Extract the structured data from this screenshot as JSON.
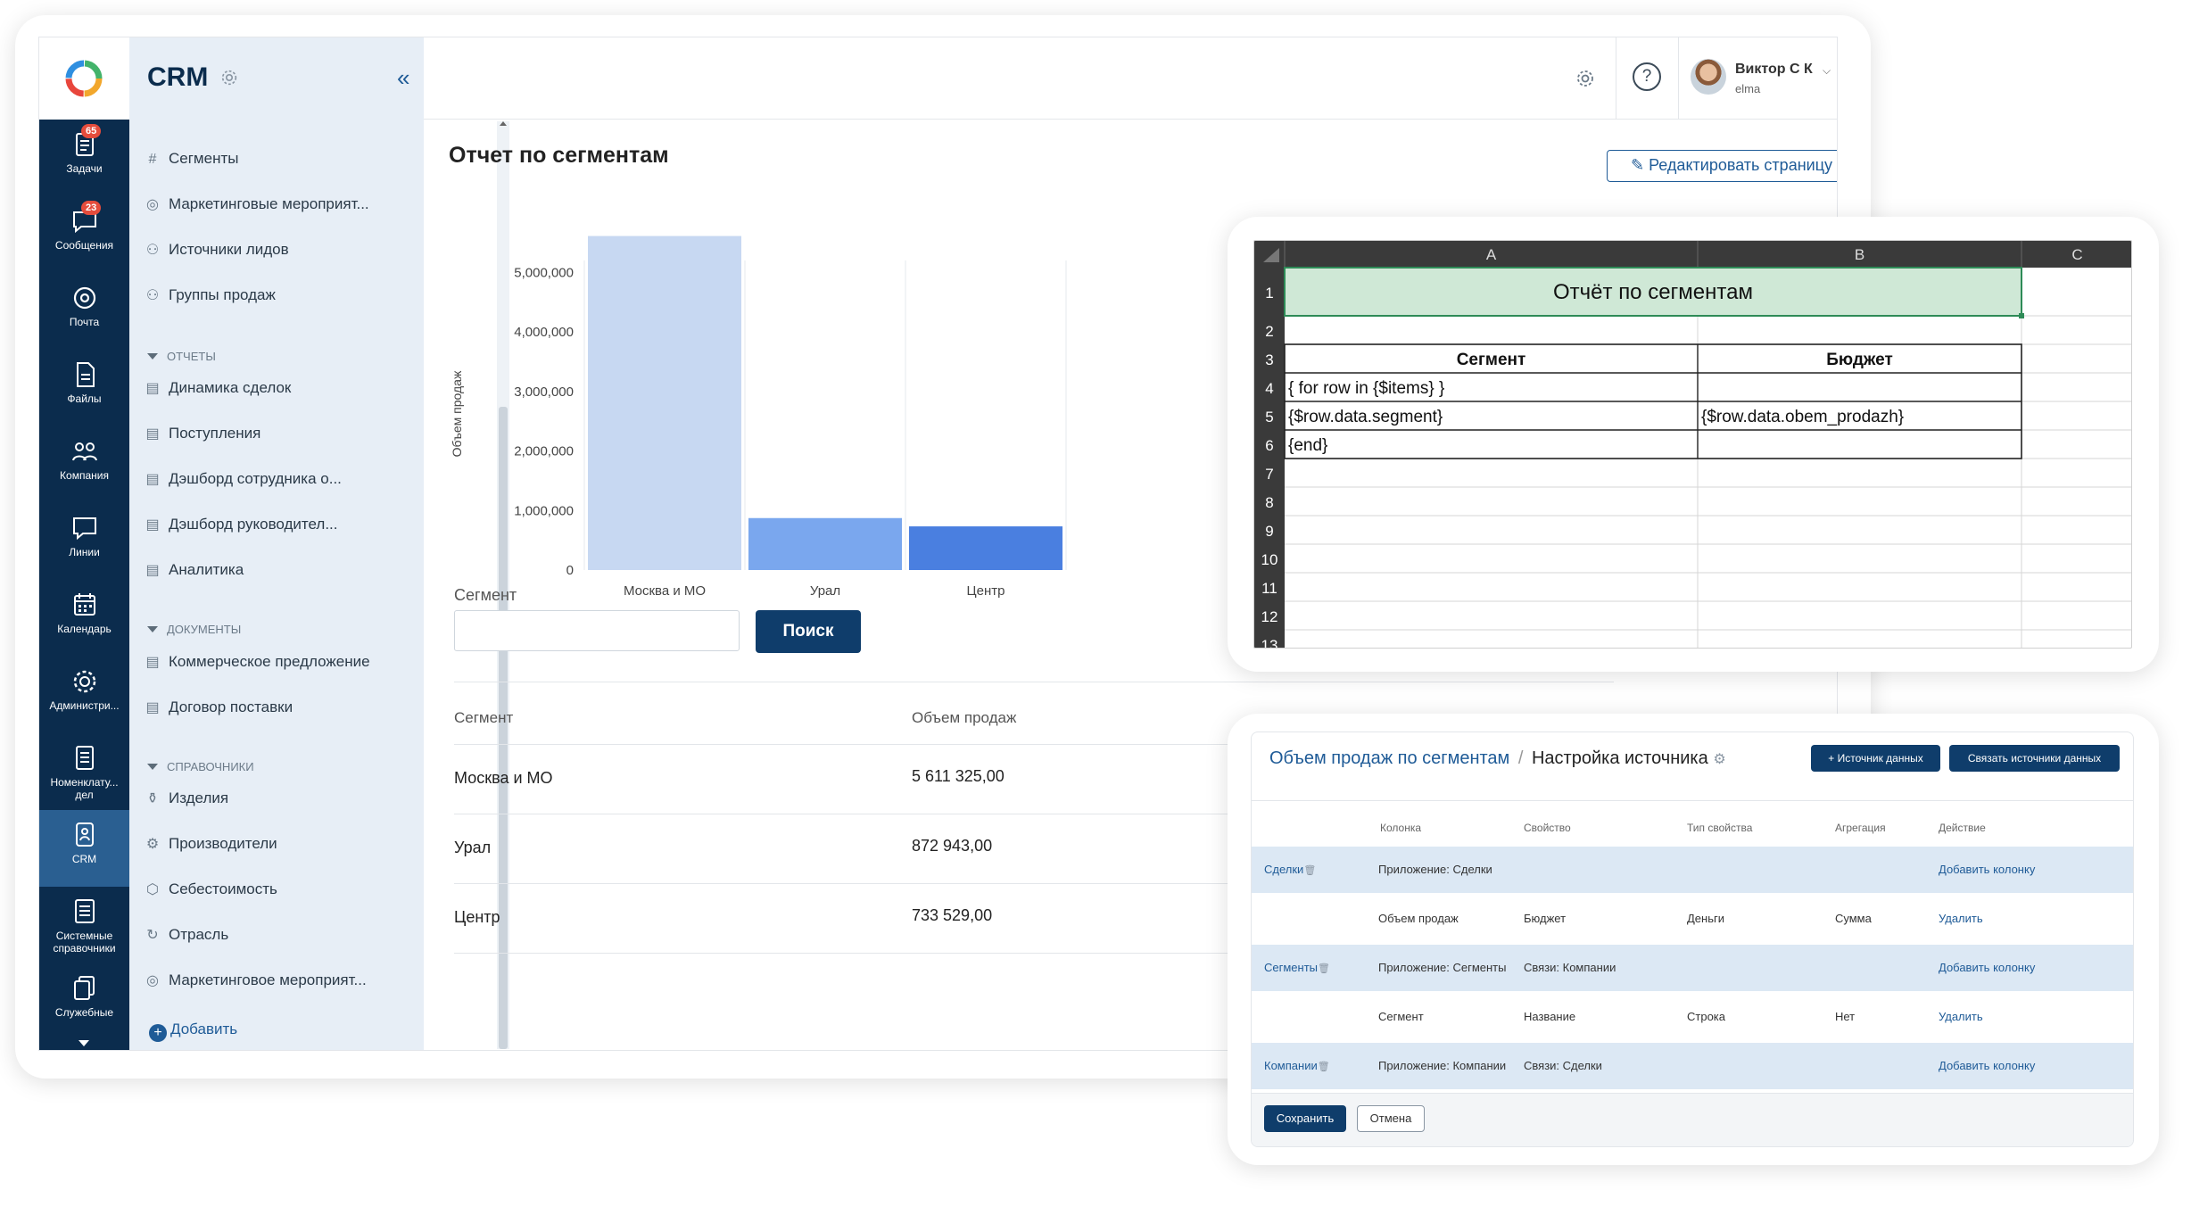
{
  "rail": {
    "items": [
      {
        "label": "Задачи",
        "badge": "65",
        "icon": "tasks-icon"
      },
      {
        "label": "Сообщения",
        "badge": "23",
        "icon": "messages-icon"
      },
      {
        "label": "Почта",
        "icon": "mail-icon"
      },
      {
        "label": "Файлы",
        "icon": "files-icon"
      },
      {
        "label": "Компания",
        "icon": "company-icon"
      },
      {
        "label": "Линии",
        "icon": "lines-icon"
      },
      {
        "label": "Календарь",
        "icon": "calendar-icon"
      },
      {
        "label": "Администри...",
        "icon": "admin-icon"
      },
      {
        "label": "Номенклату... дел",
        "icon": "nomenclature-icon"
      },
      {
        "label": "CRM",
        "icon": "crm-icon",
        "active": true
      },
      {
        "label": "Системные справочники",
        "icon": "system-directories-icon"
      },
      {
        "label": "Служебные",
        "icon": "service-icon"
      }
    ]
  },
  "sidebar": {
    "title": "CRM",
    "items_top": [
      "Сегменты",
      "Маркетинговые мероприят...",
      "Источники лидов",
      "Группы продаж"
    ],
    "reports_header": "ОТЧЕТЫ",
    "reports": [
      "Динамика сделок",
      "Поступления",
      "Дэшборд сотрудника о...",
      "Дэшборд руководител...",
      "Аналитика"
    ],
    "documents_header": "ДОКУМЕНТЫ",
    "documents": [
      "Коммерческое предложение",
      "Договор поставки"
    ],
    "directories_header": "СПРАВОЧНИКИ",
    "directories": [
      "Изделия",
      "Производители",
      "Себестоимость",
      "Отрасль",
      "Маркетинговое мероприят..."
    ],
    "add_label": "Добавить"
  },
  "topbar": {
    "user_name": "Виктор С К",
    "user_org": "elma"
  },
  "page": {
    "title": "Отчет по сегментам",
    "edit_button": "Редактировать страницу",
    "segment_label": "Сегмент",
    "search_button": "Поиск",
    "search_value": ""
  },
  "chart_data": {
    "type": "bar",
    "categories": [
      "Москва и МО",
      "Урал",
      "Центр"
    ],
    "values": [
      5611325,
      872943,
      733529
    ],
    "ylabel": "Объем продаж",
    "xlabel": "",
    "title": "",
    "ylim": [
      0,
      5500000
    ],
    "yticks": [
      0,
      1000000,
      2000000,
      3000000,
      4000000,
      5000000
    ],
    "ytick_labels": [
      "0",
      "1,000,000",
      "2,000,000",
      "3,000,000",
      "4,000,000",
      "5,000,000"
    ],
    "colors": [
      "#c7d8f2",
      "#7aa7ee",
      "#4a7fe0"
    ],
    "grid": true
  },
  "table": {
    "headers": [
      "Сегмент",
      "Объем продаж"
    ],
    "rows": [
      [
        "Москва и МО",
        "5 611 325,00"
      ],
      [
        "Урал",
        "872 943,00"
      ],
      [
        "Центр",
        "733 529,00"
      ]
    ]
  },
  "excel": {
    "columns": [
      "A",
      "B",
      "C"
    ],
    "row_numbers": [
      "1",
      "2",
      "3",
      "4",
      "5",
      "6",
      "7",
      "8",
      "9",
      "10",
      "11",
      "12",
      "13"
    ],
    "title": "Отчёт по сегментам",
    "header_a": "Сегмент",
    "header_b": "Бюджет",
    "r4a": "{ for row in {$items} }",
    "r5a": "{$row.data.segment}",
    "r5b": "{$row.data.obem_prodazh}",
    "r6a": "{end}",
    "title_fill": "#cfe8d6"
  },
  "datasource": {
    "breadcrumb_link": "Объем продаж по сегментам",
    "breadcrumb_sep": "/",
    "breadcrumb_current": "Настройка источника",
    "add_source_button": "+ Источник данных",
    "link_sources_button": "Связать источники данных",
    "headers": [
      "Колонка",
      "Свойство",
      "Тип свойства",
      "Агрегация",
      "Действие"
    ],
    "rows": [
      {
        "name": "Сделки",
        "col": "Приложение: Сделки",
        "prop": "",
        "type": "",
        "agg": "",
        "action": "Добавить колонку",
        "band": true
      },
      {
        "name": "",
        "col": "Объем продаж",
        "prop": "Бюджет",
        "type": "Деньги",
        "agg": "Сумма",
        "action": "Удалить",
        "band": false
      },
      {
        "name": "Сегменты",
        "col": "Приложение: Сегменты",
        "prop": "Связи: Компании",
        "type": "",
        "agg": "",
        "action": "Добавить колонку",
        "band": true
      },
      {
        "name": "",
        "col": "Сегмент",
        "prop": "Название",
        "type": "Строка",
        "agg": "Нет",
        "action": "Удалить",
        "band": false
      },
      {
        "name": "Компании",
        "col": "Приложение: Компании",
        "prop": "Связи: Сделки",
        "type": "",
        "agg": "",
        "action": "Добавить колонку",
        "band": true
      }
    ],
    "save_button": "Сохранить",
    "cancel_button": "Отмена"
  }
}
